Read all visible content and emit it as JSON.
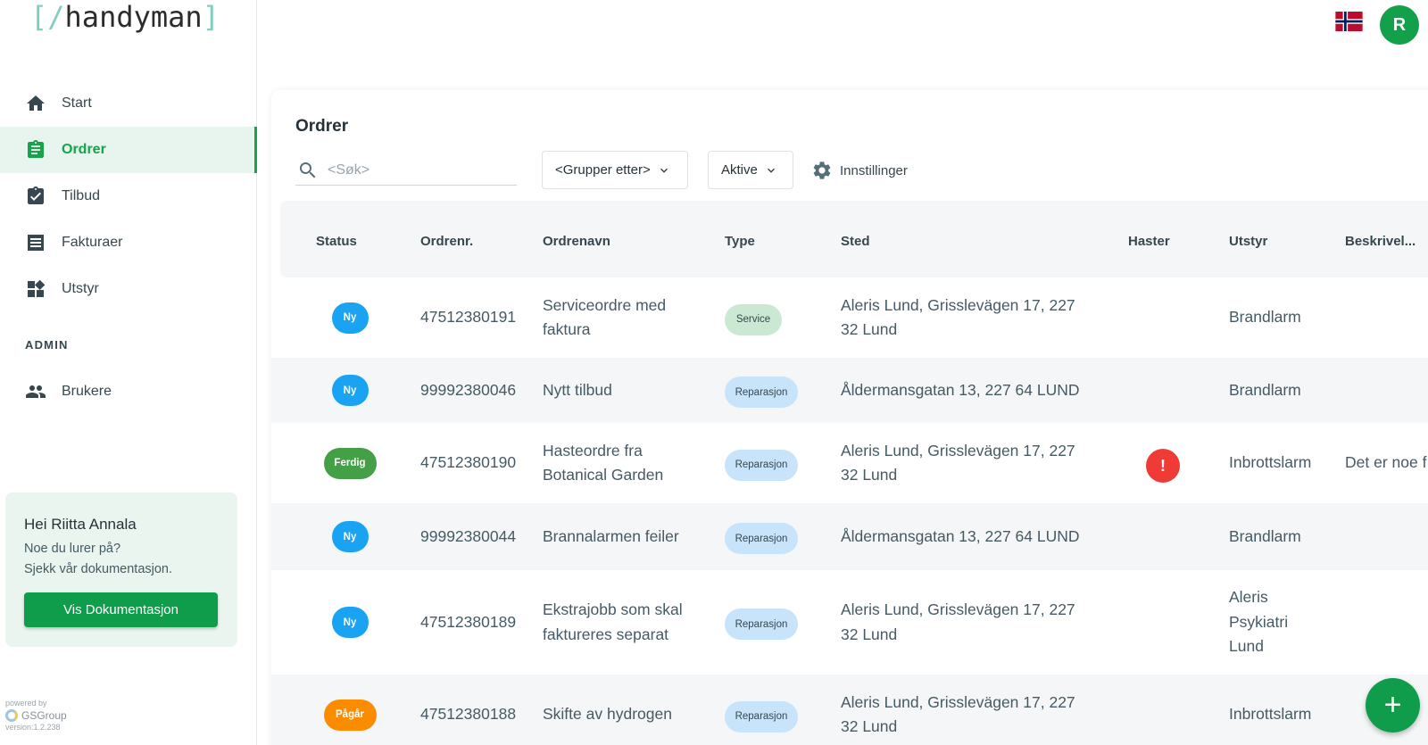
{
  "app": {
    "logo_open": "[/",
    "logo_text": "handyman",
    "logo_close": "]"
  },
  "sidebar": {
    "items": [
      {
        "label": "Start",
        "icon": "home-icon"
      },
      {
        "label": "Ordrer",
        "icon": "clipboard-icon",
        "active": true
      },
      {
        "label": "Tilbud",
        "icon": "clipboard-check-icon"
      },
      {
        "label": "Fakturaer",
        "icon": "invoice-icon"
      },
      {
        "label": "Utstyr",
        "icon": "dashboard-icon"
      }
    ],
    "admin_label": "ADMIN",
    "admin_items": [
      {
        "label": "Brukere",
        "icon": "users-icon"
      }
    ],
    "help": {
      "greeting": "Hei Riitta Annala",
      "line1": "Noe du lurer på?",
      "line2": "Sjekk vår dokumentasjon.",
      "button": "Vis Dokumentasjon"
    },
    "footer": {
      "powered_by": "powered by",
      "company": "GSGroup",
      "version": "version:1.2.238"
    }
  },
  "header": {
    "avatar_initial": "R",
    "flag": "norway-flag-icon"
  },
  "main": {
    "title": "Ordrer",
    "search_placeholder": "<Søk>",
    "group_by": "<Grupper etter>",
    "filter": "Aktive",
    "settings": "Innstillinger",
    "add_label": "+"
  },
  "table": {
    "columns": [
      "Status",
      "Ordrenr.",
      "Ordrenavn",
      "Type",
      "Sted",
      "Haster",
      "Utstyr",
      "Beskrivel..."
    ],
    "rows": [
      {
        "status": "Ny",
        "status_color": "#1aa3f2",
        "number": "47512380191",
        "name": [
          "Serviceordre med",
          "faktura"
        ],
        "type": "Service",
        "type_kind": "service",
        "place": [
          "Aleris Lund, Grisslevägen 17, 227",
          "32 Lund"
        ],
        "urgent": "",
        "equipment": [
          "Brandlarm"
        ],
        "description": ""
      },
      {
        "status": "Ny",
        "status_color": "#1aa3f2",
        "number": "99992380046",
        "name": [
          "Nytt tilbud"
        ],
        "type": "Reparasjon",
        "type_kind": "rep",
        "place": [
          "Åldermansgatan 13, 227 64 LUND"
        ],
        "urgent": "",
        "equipment": [
          "Brandlarm"
        ],
        "description": ""
      },
      {
        "status": "Ferdig",
        "status_color": "#43a047",
        "number": "47512380190",
        "name": [
          "Hasteordre fra",
          "Botanical Garden"
        ],
        "type": "Reparasjon",
        "type_kind": "rep",
        "place": [
          "Aleris Lund, Grisslevägen 17, 227",
          "32 Lund"
        ],
        "urgent": "!",
        "equipment": [
          "Inbrottslarm"
        ],
        "description": "Det er noe f"
      },
      {
        "status": "Ny",
        "status_color": "#1aa3f2",
        "number": "99992380044",
        "name": [
          "Brannalarmen feiler"
        ],
        "type": "Reparasjon",
        "type_kind": "rep",
        "place": [
          "Åldermansgatan 13, 227 64 LUND"
        ],
        "urgent": "",
        "equipment": [
          "Brandlarm"
        ],
        "description": ""
      },
      {
        "status": "Ny",
        "status_color": "#1aa3f2",
        "number": "47512380189",
        "name": [
          "Ekstrajobb som skal",
          "faktureres separat"
        ],
        "type": "Reparasjon",
        "type_kind": "rep",
        "place": [
          "Aleris Lund, Grisslevägen 17, 227",
          "32 Lund"
        ],
        "urgent": "",
        "equipment": [
          "Aleris",
          "Psykiatri",
          "Lund"
        ],
        "description": ""
      },
      {
        "status": "Pågår",
        "status_color": "#fb8c00",
        "number": "47512380188",
        "name": [
          "Skifte av hydrogen"
        ],
        "type": "Reparasjon",
        "type_kind": "rep",
        "place": [
          "Aleris Lund, Grisslevägen 17, 227",
          "32 Lund"
        ],
        "urgent": "",
        "equipment": [
          "Inbrottslarm"
        ],
        "description": ""
      }
    ]
  }
}
